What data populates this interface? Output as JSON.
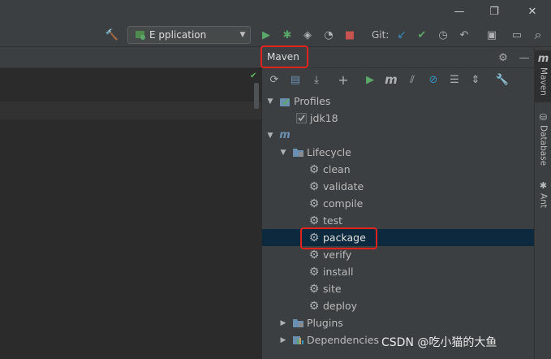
{
  "window": {
    "minimize_icon": "minimize-icon",
    "maximize_icon": "restore-icon",
    "close_icon": "close-icon",
    "minimize_glyph": "—",
    "maximize_glyph": "❐",
    "close_glyph": "✕"
  },
  "toolbar": {
    "run_config_label": "E          pplication",
    "git_label": "Git:",
    "build_glyph": "🔨",
    "run_glyph": "▶",
    "debug_glyph": "✱",
    "coverage_glyph": "◈",
    "profile_glyph": "◔",
    "stop_glyph": "■",
    "update_glyph": "↙",
    "commit_glyph": "✔",
    "history_glyph": "◷",
    "rollback_glyph": "↶",
    "project_glyph": "▣",
    "layout_glyph": "▭",
    "search_glyph": "⌕",
    "caret_glyph": "▼"
  },
  "maven": {
    "title": "Maven",
    "settings_glyph": "⚙",
    "hide_glyph": "—",
    "tools": {
      "reload": "⟳",
      "generate": "▤",
      "download": "⤓",
      "add": "+",
      "run": "▶",
      "execute": "m",
      "offline": "⫽",
      "skip_tests": "⊘",
      "collapse": "☰",
      "expand": "⇕",
      "settings": "🔧"
    },
    "tree": {
      "profiles": "Profiles",
      "jdk": "jdk18",
      "project": "",
      "lifecycle": "Lifecycle",
      "goals": [
        "clean",
        "validate",
        "compile",
        "test",
        "package",
        "verify",
        "install",
        "site",
        "deploy"
      ],
      "plugins": "Plugins",
      "dependencies": "Dependencies"
    }
  },
  "right_strip": {
    "maven": "Maven",
    "database": "Database",
    "ant": "Ant"
  },
  "watermark": "CSDN @吃小猫的大鱼",
  "colors": {
    "highlight": "#e0241b",
    "selection": "#0d293e",
    "run_green": "#59a869",
    "stop_red": "#c75450",
    "git_blue": "#3592c4"
  }
}
